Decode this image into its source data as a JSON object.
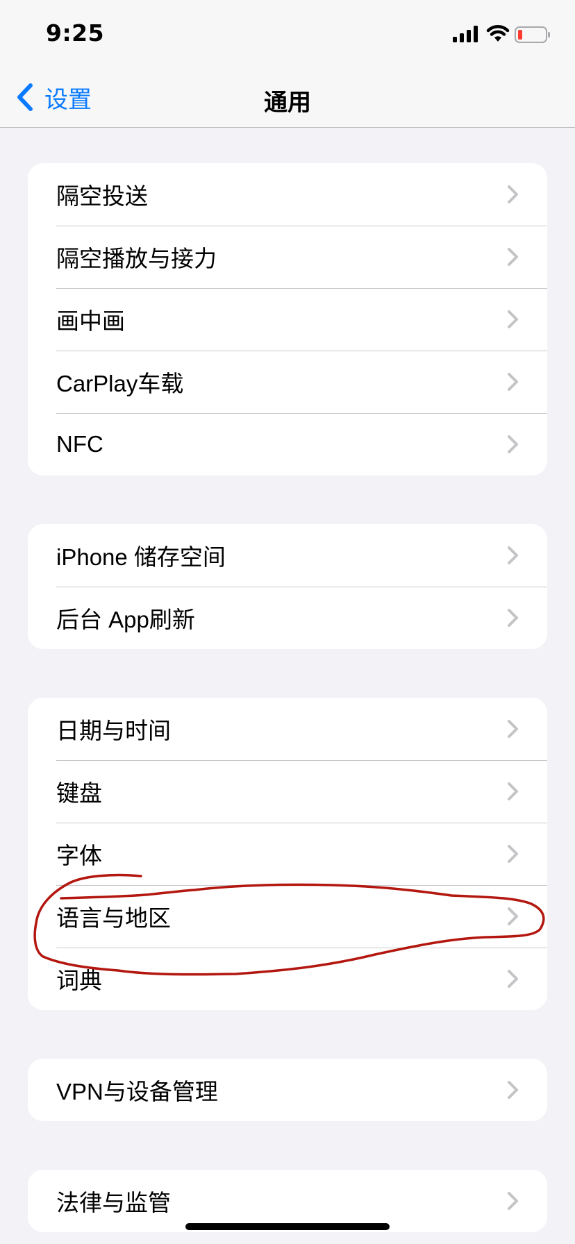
{
  "status_bar": {
    "time": "9:25",
    "icons": [
      "signal-icon",
      "wifi-icon",
      "battery-icon"
    ],
    "battery_color": "#ff3b30"
  },
  "nav": {
    "back_label": "设置",
    "title": "通用",
    "accent_color": "#0a7bff"
  },
  "groups": [
    {
      "items": [
        {
          "label": "隔空投送"
        },
        {
          "label": "隔空播放与接力"
        },
        {
          "label": "画中画"
        },
        {
          "label": "CarPlay车载"
        },
        {
          "label": "NFC"
        }
      ]
    },
    {
      "items": [
        {
          "label": "iPhone 储存空间"
        },
        {
          "label": "后台 App刷新"
        }
      ]
    },
    {
      "items": [
        {
          "label": "日期与时间"
        },
        {
          "label": "键盘"
        },
        {
          "label": "字体"
        },
        {
          "label": "语言与地区"
        },
        {
          "label": "词典"
        }
      ]
    },
    {
      "items": [
        {
          "label": "VPN与设备管理"
        }
      ]
    },
    {
      "items": [
        {
          "label": "法律与监管"
        }
      ]
    }
  ],
  "annotation": {
    "highlighted_item": "语言与地区",
    "color": "#b3170f"
  }
}
